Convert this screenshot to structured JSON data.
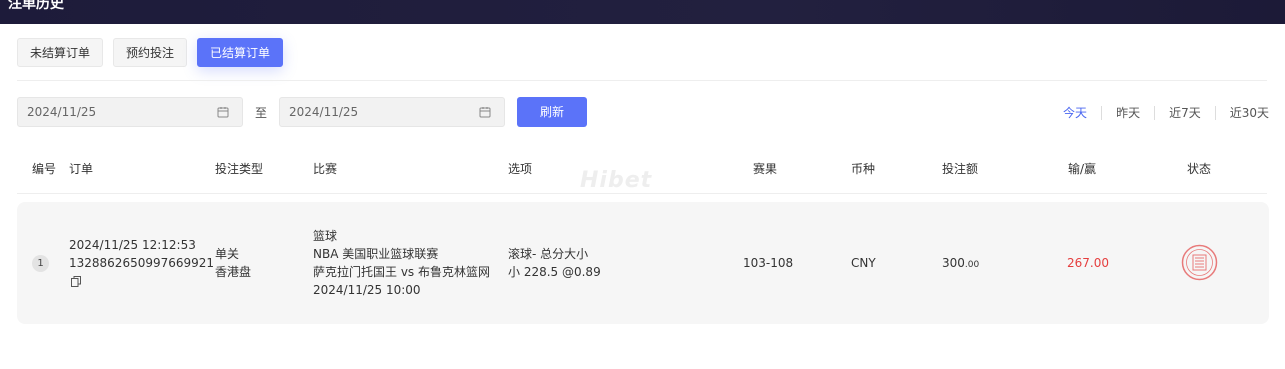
{
  "header": {
    "title": "注单历史"
  },
  "tabs": [
    {
      "label": "未结算订单",
      "active": false
    },
    {
      "label": "预约投注",
      "active": false
    },
    {
      "label": "已结算订单",
      "active": true
    }
  ],
  "filter": {
    "start_date": "2024/11/25",
    "end_date": "2024/11/25",
    "to_label": "至",
    "refresh_label": "刷新",
    "quick_ranges": [
      "今天",
      "昨天",
      "近7天",
      "近30天"
    ],
    "active_range": "今天"
  },
  "table": {
    "columns": [
      "编号",
      "订单",
      "投注类型",
      "比赛",
      "选项",
      "赛果",
      "币种",
      "投注额",
      "输/赢",
      "状态"
    ],
    "rows": [
      {
        "index": "1",
        "order_time": "2024/11/25 12:12:53",
        "order_id": "1328862650997669921",
        "bet_type": "单关",
        "odds_type": "香港盘",
        "sport": "篮球",
        "league": "NBA 美国职业篮球联赛",
        "match": "萨克拉门托国王 vs 布鲁克林篮网",
        "match_time": "2024/11/25 10:00",
        "option_market": "滚球- 总分大小",
        "option_pick": "小 228.5 @0.89",
        "result": "103-108",
        "currency": "CNY",
        "stake_int": "300",
        "stake_dec": ".00",
        "win_loss": "267.00",
        "status_icon": "settled-stamp-icon"
      }
    ]
  },
  "watermark": "Hibet",
  "colors": {
    "accent": "#5b73f9",
    "win": "#e53e3e",
    "header_bg": "#1d1b3a"
  }
}
